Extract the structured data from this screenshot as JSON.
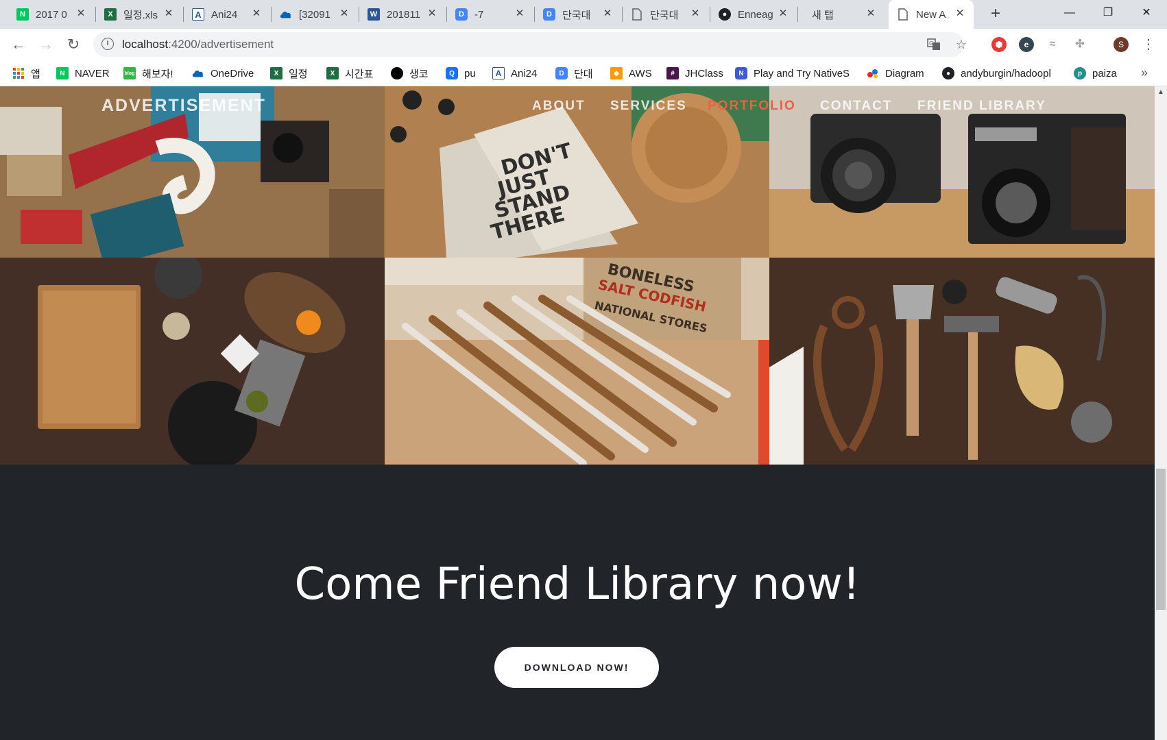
{
  "tabs": [
    {
      "title": "2017 0",
      "icon": "naver-icon",
      "color": "#03c75a"
    },
    {
      "title": "일정.xls",
      "icon": "excel-icon",
      "color": "#1d6f42"
    },
    {
      "title": "Ani24",
      "icon": "ani24-icon",
      "color": "#2b579a"
    },
    {
      "title": "[32091",
      "icon": "onedrive-icon",
      "color": "#0364b8"
    },
    {
      "title": "201811",
      "icon": "word-icon",
      "color": "#2b579a"
    },
    {
      "title": "-7",
      "icon": "doc-d-icon",
      "color": "#4285f4"
    },
    {
      "title": "단국대",
      "icon": "doc-d-icon",
      "color": "#4285f4"
    },
    {
      "title": "단국대",
      "icon": "page-icon",
      "color": "#5f6368"
    },
    {
      "title": "Enneag",
      "icon": "github-icon",
      "color": "#202124"
    },
    {
      "title": "새 탭",
      "icon": "",
      "color": ""
    },
    {
      "title": "New A",
      "icon": "page-icon",
      "color": "#5f6368"
    }
  ],
  "url": {
    "host": "localhost",
    "rest": ":4200/advertisement"
  },
  "profile_initial": "S",
  "bookmarks": [
    {
      "label": "앱",
      "icon": "apps-grid-icon",
      "color": "#ea4335"
    },
    {
      "label": "NAVER",
      "icon": "naver-icon",
      "color": "#03c75a"
    },
    {
      "label": "해보자!",
      "icon": "blog-icon",
      "color": "#37b34a"
    },
    {
      "label": "OneDrive",
      "icon": "onedrive-icon",
      "color": "#0364b8"
    },
    {
      "label": "일정",
      "icon": "excel-icon",
      "color": "#1d6f42"
    },
    {
      "label": "시간표",
      "icon": "excel-icon",
      "color": "#1d6f42"
    },
    {
      "label": "생코",
      "icon": "circle-icon",
      "color": "#000000"
    },
    {
      "label": "pu",
      "icon": "q-icon",
      "color": "#1a73e8"
    },
    {
      "label": "Ani24",
      "icon": "ani24-icon",
      "color": "#2b579a"
    },
    {
      "label": "단대",
      "icon": "doc-d-icon",
      "color": "#4285f4"
    },
    {
      "label": "AWS",
      "icon": "aws-cube-icon",
      "color": "#ff9900"
    },
    {
      "label": "JHClass",
      "icon": "hash-icon",
      "color": "#4a154b"
    },
    {
      "label": "Play and Try NativeS",
      "icon": "n-icon",
      "color": "#3b5bdb"
    },
    {
      "label": "Diagram",
      "icon": "diagram-icon",
      "color": "#d93025"
    },
    {
      "label": "andyburgin/hadoopl",
      "icon": "github-icon",
      "color": "#202124"
    },
    {
      "label": "paiza",
      "icon": "paiza-icon",
      "color": "#1f8f8f"
    }
  ],
  "site": {
    "brand": "ADVERTISEMENT",
    "nav": [
      {
        "label": "ABOUT",
        "active": false
      },
      {
        "label": "SERVICES",
        "active": false
      },
      {
        "label": "PORTFOLIO",
        "active": true
      },
      {
        "label": "CONTACT",
        "active": false
      },
      {
        "label": "FRIEND LIBRARY",
        "active": false
      }
    ],
    "cta_title": "Come Friend Library now!",
    "cta_button": "DOWNLOAD NOW!",
    "colors": {
      "accent": "#f05f40",
      "dark": "#212529"
    }
  }
}
